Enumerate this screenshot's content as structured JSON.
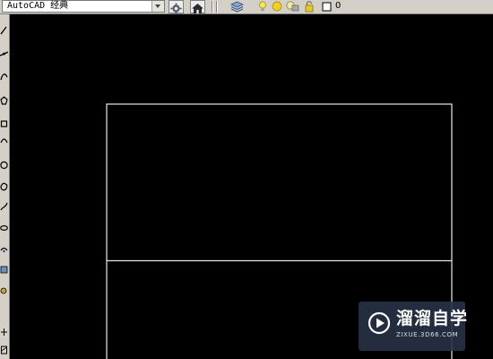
{
  "toolbar": {
    "workspace": {
      "value": "AutoCAD 经典",
      "dropdown_icon": "chevron-down-icon"
    },
    "buttons": [
      {
        "name": "workspace-settings",
        "icon": "gear-icon"
      },
      {
        "name": "workspace-home",
        "icon": "home-icon"
      },
      {
        "name": "layer-properties",
        "icon": "layers-icon"
      }
    ],
    "layer": {
      "on_icon": "lightbulb-icon",
      "freeze_icon": "sun-icon",
      "viewport_icon": "viewport-freeze-icon",
      "lock_icon": "lock-icon",
      "color_icon": "color-swatch-icon",
      "name": "0"
    }
  },
  "draw_toolbar": {
    "tools": [
      "line-icon",
      "construction-line-icon",
      "polyline-icon",
      "polygon-icon",
      "rectangle-icon",
      "arc-icon",
      "circle-icon",
      "revision-cloud-icon",
      "spline-icon",
      "ellipse-icon",
      "ellipse-arc-icon",
      "insert-block-icon",
      "make-block-icon",
      "point-icon",
      "hatch-icon"
    ]
  },
  "drawing": {
    "background": "#000000",
    "line_color": "#ffffff",
    "shapes": [
      "outer-rectangle",
      "dividing-line"
    ]
  },
  "watermark": {
    "brand": "溜溜自学",
    "url": "ZIXUE.3D66.COM",
    "icon": "play-logo-icon"
  }
}
